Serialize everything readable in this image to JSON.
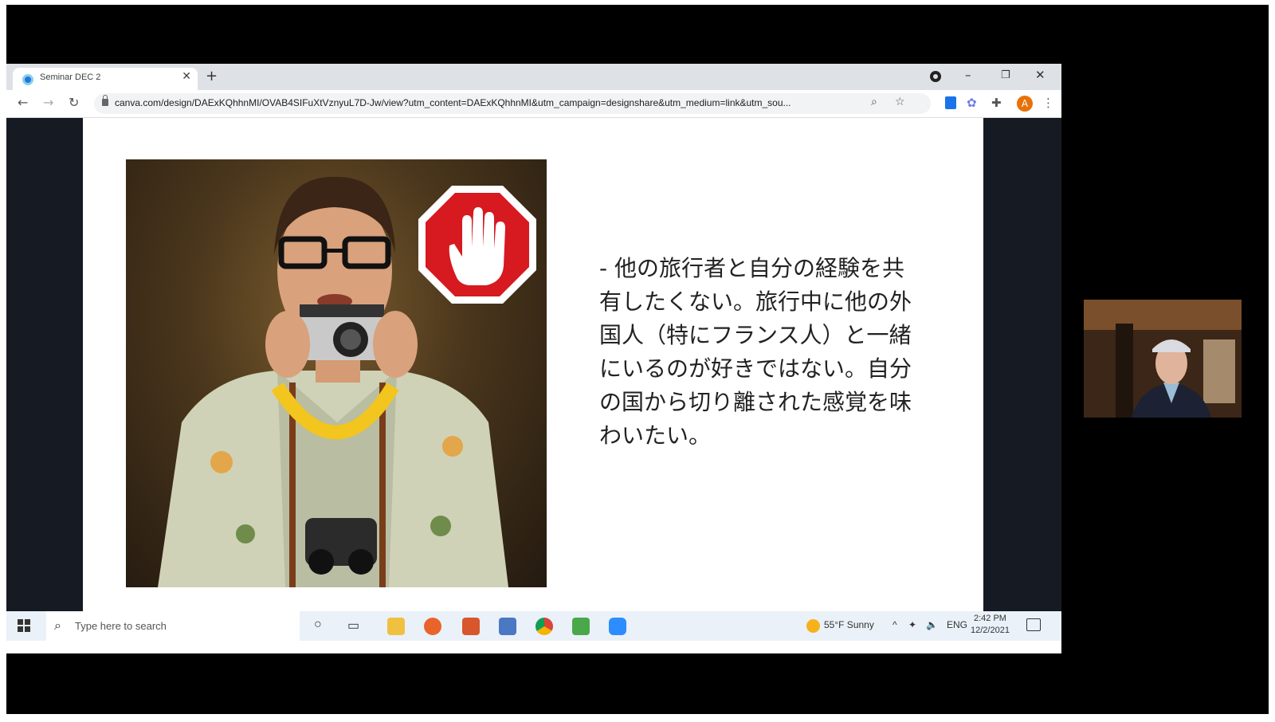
{
  "browser": {
    "tab_title": "Seminar DEC 2",
    "new_tab_icon": "+",
    "url": "canva.com/design/DAExKQhhnMI/OVAB4SIFuXtVznyuL7D-Jw/view?utm_content=DAExKQhhnMI&utm_campaign=designshare&utm_medium=link&utm_sou..."
  },
  "slide": {
    "text": "- 他の旅行者と自分の経験を共有したくない。旅行中に他の外国人（特にフランス人）と一緒にいるのが好きではない。自分の国から切り離された感覚を味わいたい。",
    "stop_sign_color": "#d71920"
  },
  "taskbar": {
    "search_placeholder": "Type here to search",
    "weather": "55°F  Sunny",
    "language": "ENG",
    "time": "2:42 PM",
    "date": "12/2/2021"
  },
  "colors": {
    "accent_orange": "#e8710a",
    "chrome_blue": "#1a73e8"
  }
}
